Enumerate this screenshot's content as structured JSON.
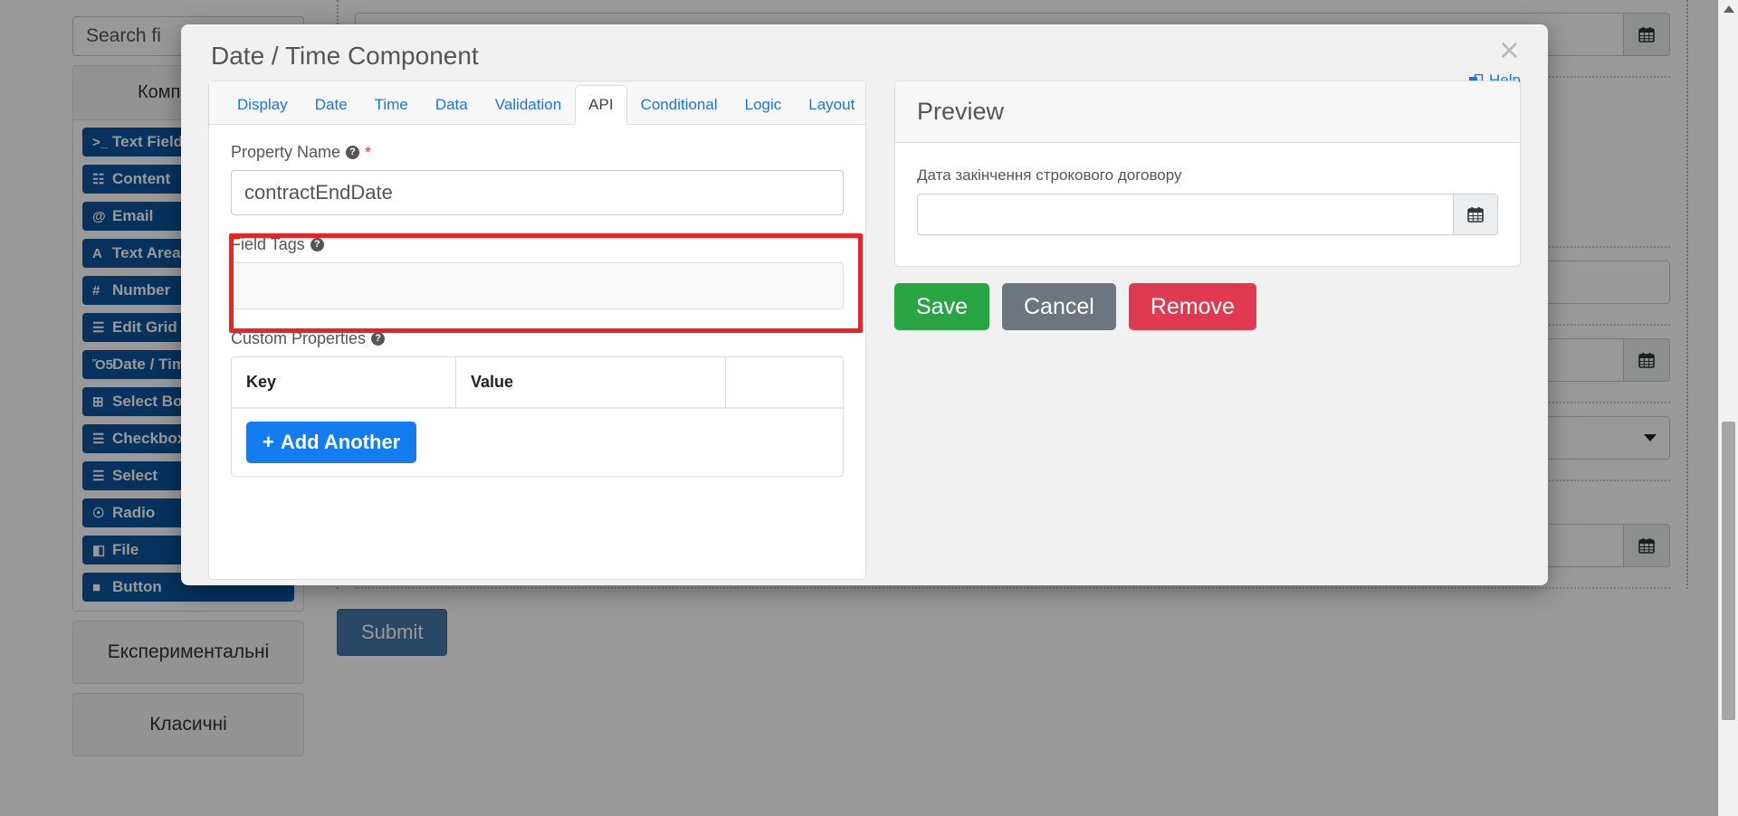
{
  "backdrop": {
    "search": {
      "value": "Search fi",
      "placeholder": "Search field(s)"
    },
    "components_panel": {
      "title": "Компоненти",
      "items": [
        {
          "label": "Text Field",
          "icon": "terminal-icon",
          "glyph": ">_"
        },
        {
          "label": "Content",
          "icon": "content-icon",
          "glyph": "☷"
        },
        {
          "label": "Email",
          "icon": "at-icon",
          "glyph": "@"
        },
        {
          "label": "Text Area",
          "icon": "text-area-icon",
          "glyph": "A"
        },
        {
          "label": "Number",
          "icon": "hash-icon",
          "glyph": "#"
        },
        {
          "label": "Edit Grid",
          "icon": "grid-icon",
          "glyph": "☰"
        },
        {
          "label": "Date / Time",
          "icon": "calendar-icon",
          "glyph": "Ὄ5"
        },
        {
          "label": "Select Boxes",
          "icon": "plus-square-icon",
          "glyph": "⊞"
        },
        {
          "label": "Checkbox",
          "icon": "list-icon",
          "glyph": "☰"
        },
        {
          "label": "Select",
          "icon": "list-icon",
          "glyph": "☰"
        },
        {
          "label": "Radio",
          "icon": "radio-icon",
          "glyph": "☉"
        },
        {
          "label": "File",
          "icon": "file-icon",
          "glyph": "◧"
        },
        {
          "label": "Button",
          "icon": "square-icon",
          "glyph": "■"
        }
      ]
    },
    "accordions": [
      {
        "label": "Експериментальні"
      },
      {
        "label": "Класичні"
      }
    ],
    "form_fields": [
      {
        "label": "",
        "type": "date"
      },
      {
        "label": "",
        "type": "text"
      },
      {
        "label": "",
        "type": "date"
      },
      {
        "label": "",
        "type": "select"
      },
      {
        "label": "Дата закінчення строкового договору",
        "type": "date"
      }
    ],
    "submit_label": "Submit"
  },
  "modal": {
    "title": "Date / Time Component",
    "close_label": "×",
    "help_label": "Help",
    "tabs": [
      {
        "label": "Display",
        "active": false
      },
      {
        "label": "Date",
        "active": false
      },
      {
        "label": "Time",
        "active": false
      },
      {
        "label": "Data",
        "active": false
      },
      {
        "label": "Validation",
        "active": false
      },
      {
        "label": "API",
        "active": true
      },
      {
        "label": "Conditional",
        "active": false
      },
      {
        "label": "Logic",
        "active": false
      },
      {
        "label": "Layout",
        "active": false
      }
    ],
    "api_tab": {
      "property_name": {
        "label": "Property Name",
        "required_marker": "*",
        "help_glyph": "?",
        "value": "contractEndDate"
      },
      "field_tags": {
        "label": "Field Tags",
        "help_glyph": "?",
        "value": ""
      },
      "custom_properties": {
        "label": "Custom Properties",
        "help_glyph": "?",
        "columns": [
          "Key",
          "Value",
          ""
        ],
        "rows": [],
        "add_button_label": "Add Another",
        "add_button_glyph": "+"
      }
    },
    "preview": {
      "title": "Preview",
      "field_label": "Дата закінчення строкового договору",
      "field_value": ""
    },
    "actions": {
      "save": "Save",
      "cancel": "Cancel",
      "remove": "Remove"
    },
    "colors": {
      "highlight": "#ee2222",
      "accent_link": "#1a73e8",
      "save": "#2aa544",
      "cancel": "#6d767e",
      "remove": "#e03a50",
      "add_another": "#127cf0",
      "component_button": "#0a549b"
    }
  }
}
